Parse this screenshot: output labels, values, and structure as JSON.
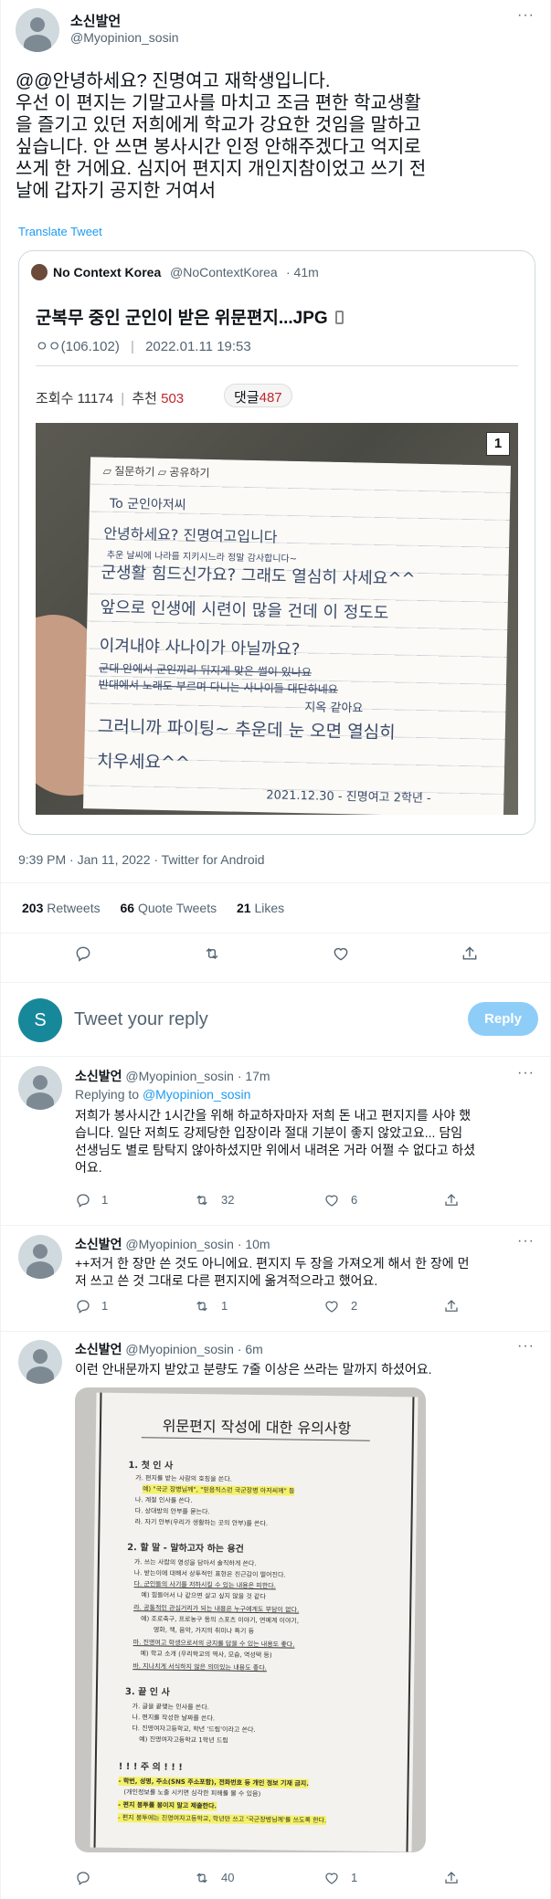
{
  "main_tweet": {
    "name": "소신발언",
    "handle": "@Myopinion_sosin",
    "text_lines": [
      "@@안녕하세요? 진명여고 재학생입니다.",
      "우선 이 편지는 기말고사를 마치고 조금 편한 학교생활",
      "을 즐기고 있던 저희에게 학교가 강요한 것임을 말하고",
      "싶습니다. 안 쓰면 봉사시간 인정 안해주겠다고 억지로",
      "쓰게 한 거에요. 심지어 편지지 개인지참이었고 쓰기 전",
      "날에 갑자기 공지한 거여서"
    ],
    "translate": "Translate Tweet",
    "timestamp": "9:39 PM · Jan 11, 2022 · Twitter for Android",
    "retweets": "203",
    "retweets_label": "Retweets",
    "quotes": "66",
    "quotes_label": "Quote Tweets",
    "likes": "21",
    "likes_label": "Likes"
  },
  "quoted": {
    "name": "No Context Korea",
    "handle": "@NoContextKorea",
    "time": "· 41m",
    "title": "군복무 중인 군인이 받은 위문편지...JPG",
    "meta_left": "ㅇㅇ(106.102)",
    "meta_date": "2022.01.11 19:53",
    "views_label": "조회수",
    "views": "11174",
    "recommend_label": "추천",
    "recommend": "503",
    "comments_label": "댓글",
    "comments": "487",
    "image_badge": "1",
    "letter_lines": [
      "To 군인아저씨",
      "안녕하세요? 진명여고입니다",
      "추운 날씨에 나라를 지키시느라 정말 감사합니다~",
      "군생활 힘드신가요? 그래도 열심히 사세요^^",
      "앞으로 인생에 시련이 많을 건데 이 정도도",
      "이겨내야 사나이가 아닐까요?",
      "군대 안에서 군인끼리 뒤지게 맞은 썰이 있나요",
      "반대에서 노래도 부르며 다니는 사나이들 대단하네요",
      "지옥 같아요",
      "그러니까 파이팅~ 추운데 눈 오면 열심히",
      "치우세요^^",
      "2021.12.30  - 진명여고 2학년 -"
    ]
  },
  "reply_box": {
    "avatar_letter": "S",
    "placeholder": "Tweet your reply",
    "button": "Reply"
  },
  "replies": [
    {
      "name": "소신발언",
      "handle": "@Myopinion_sosin",
      "time": "· 17m",
      "replying_prefix": "Replying to",
      "replying_to": "@Myopinion_sosin",
      "lines": [
        "저희가 봉사시간 1시간을 위해 하교하자마자 저희 돈 내고 편지지를 사야 했",
        "습니다. 일단 저희도 강제당한 입장이라 절대 기분이 좋지 않았고요... 담임",
        "선생님도 별로 탐탁지 않아하셨지만 위에서 내려온 거라 어쩔 수 없다고 하셨",
        "어요."
      ],
      "reply_count": "1",
      "retweet_count": "32",
      "like_count": "6"
    },
    {
      "name": "소신발언",
      "handle": "@Myopinion_sosin",
      "time": "· 10m",
      "lines": [
        "++저거 한 장만 쓴 것도 아니에요. 편지지 두 장을 가져오게 해서 한 장에 먼",
        "저 쓰고 쓴 것 그대로 다른 편지지에 옮겨적으라고 했어요."
      ],
      "reply_count": "1",
      "retweet_count": "1",
      "like_count": "2"
    },
    {
      "name": "소신발언",
      "handle": "@Myopinion_sosin",
      "time": "· 6m",
      "lines": [
        "이런 안내문까지 받았고 분량도 7줄 이상은 쓰라는 말까지 하셨어요."
      ],
      "reply_count": "",
      "retweet_count": "40",
      "like_count": "1"
    }
  ],
  "notice": {
    "title": "위문편지 작성에 대한 유의사항",
    "lines": [
      "1. 첫 인 사",
      "가. 편지를 받는 사람의 호칭을 쓴다.",
      "예) \"국군 장병님께\", \"믿음직스런 국군장병 아저씨께\" 등",
      "나. 계절 인사를 쓴다.",
      "다. 상대방의 안부를 묻는다.",
      "라. 자기 안부(우리가 생활하는 곳의 안부)를 쓴다.",
      "2. 할 말 - 말하고자 하는 용건",
      "가. 쓰는 사람의 영성을 담아서 솔직하게 쓴다.",
      "나. 받는이에 대해서 상투적인 표현은 친근감이 떨어진다.",
      "다. 군인들의 사기를 저하시킬 수 있는 내용은 피한다.",
      "예) 힘들어서 나 같으면 살고 싶지 않을 것 같다",
      "라. 공통적인 관심거리가 되는 내용은 누구에게도 부담이 없다.",
      "예) 조로축구, 프로농구 등의 스포츠 이야기, 연예계 이야기,",
      "영화, 책, 음악, 가지의 취미나 특기 등",
      "마. 진명여고 학생으로서의 긍지를 담을 수 있는 내용도 좋다.",
      "예) 학교 소개 (우리학교의 역사, 모습, 역성택 등)",
      "바. 지나치게 서식하지 않은 의미있는 내용도 좋다.",
      "3. 끝 인 사",
      "가. 글을 끝맺는 인사를 쓴다.",
      "나. 편지를 작성한 날짜를 쓴다.",
      "다. 진명여자고등학교, 학년 '드림'이라고 쓴다.",
      "예) 진명여자고등학교 1학년 드림",
      "! ! ! 주     의 ! ! !",
      "- 학번, 성명, 주소(SNS 주소포함), 전화번호 등 개인 정보 기재 금지.",
      "(개인정보를 노출 시키면 심각한 피해를 볼 수 있음)",
      "- 편지 봉투를 봉이지 말고 제출한다.",
      "- 편지 봉투에는 진명여자고등학교, 학년만 쓰고 '국군장병님께'를 쓰도록 한다."
    ]
  },
  "colors": {
    "accent": "#1d9bf0",
    "reply_button": "#8ecdf8",
    "reply_avatar": "#17889a",
    "text": "#0f1419",
    "muted": "#536471",
    "red": "#c1272d",
    "highlight": "#f4f168"
  }
}
